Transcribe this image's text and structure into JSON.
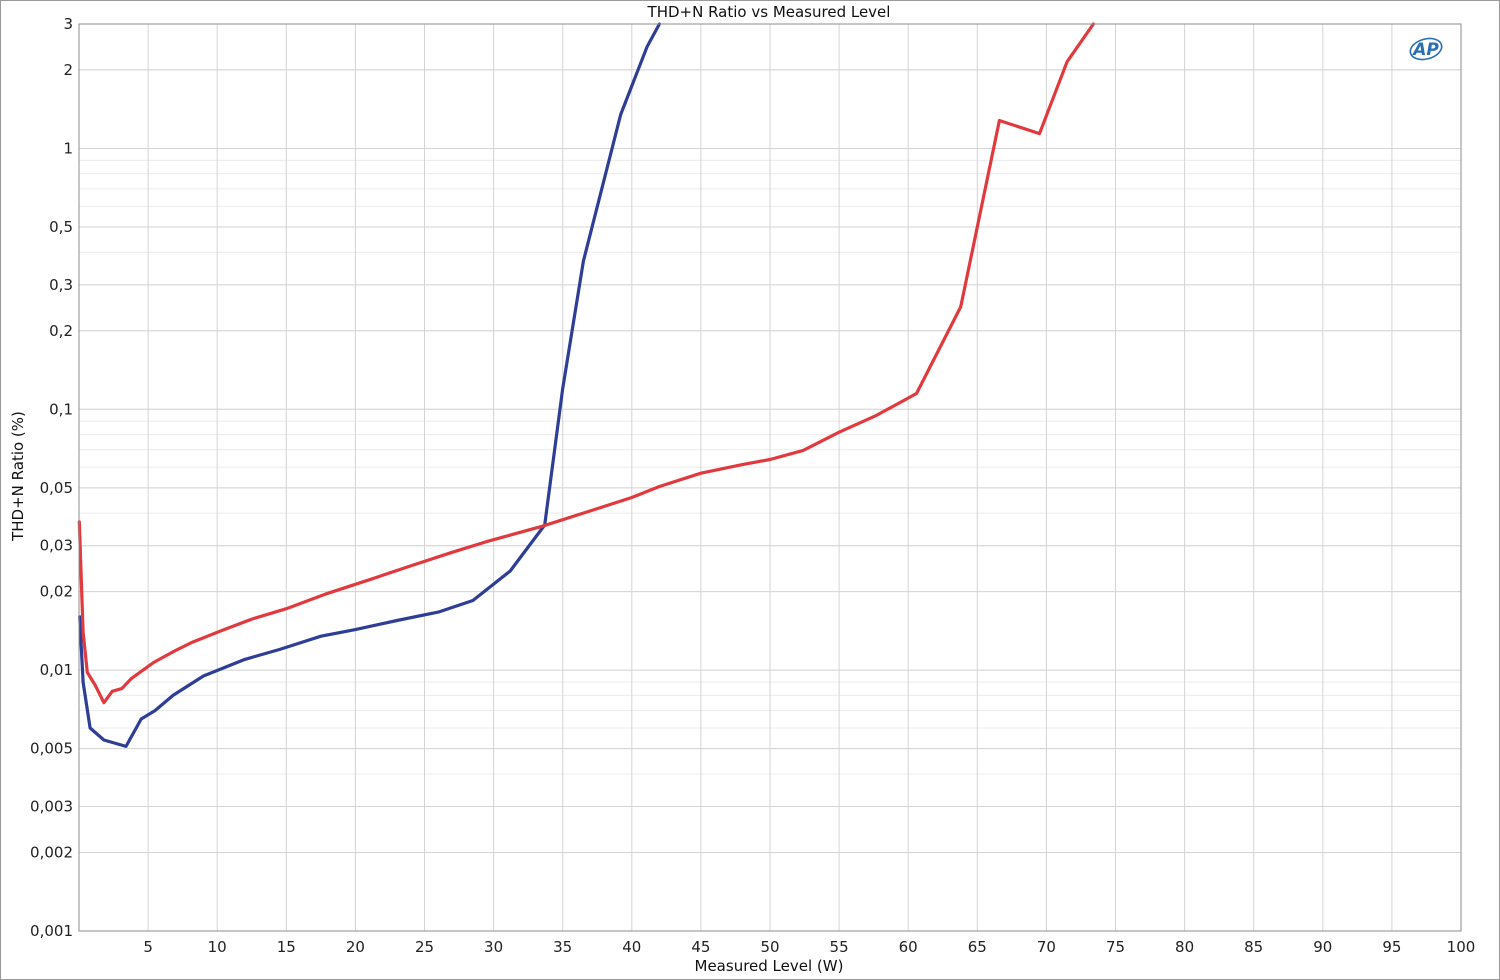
{
  "chart_data": {
    "type": "line",
    "title": "THD+N Ratio vs Measured Level",
    "xlabel": "Measured Level (W)",
    "ylabel": "THD+N Ratio (%)",
    "xlim": [
      0,
      100
    ],
    "ylim": [
      0.001,
      3
    ],
    "yscale": "log",
    "grid": true,
    "x_ticks": [
      5,
      10,
      15,
      20,
      25,
      30,
      35,
      40,
      45,
      50,
      55,
      60,
      65,
      70,
      75,
      80,
      85,
      90,
      95,
      100
    ],
    "x_tick_labels": [
      "5",
      "10",
      "15",
      "20",
      "25",
      "30",
      "35",
      "40",
      "45",
      "50",
      "55",
      "60",
      "65",
      "70",
      "75",
      "80",
      "85",
      "90",
      "95",
      "100"
    ],
    "y_ticks": [
      3,
      2,
      1,
      0.5,
      0.3,
      0.2,
      0.1,
      0.05,
      0.03,
      0.02,
      0.01,
      0.005,
      0.003,
      0.002,
      0.001
    ],
    "y_tick_labels": [
      "3",
      "2",
      "1",
      "0,5",
      "0,3",
      "0,2",
      "0,1",
      "0,05",
      "0,03",
      "0,02",
      "0,01",
      "0,005",
      "0,003",
      "0,002",
      "0,001"
    ],
    "series": [
      {
        "color": "#2e3d96",
        "points": [
          [
            0.05,
            0.016
          ],
          [
            0.3,
            0.009
          ],
          [
            0.8,
            0.006
          ],
          [
            1.8,
            0.0054
          ],
          [
            3.4,
            0.0051
          ],
          [
            4.5,
            0.0065
          ],
          [
            5.5,
            0.007
          ],
          [
            6.8,
            0.008
          ],
          [
            9,
            0.0095
          ],
          [
            12,
            0.011
          ],
          [
            14.5,
            0.012
          ],
          [
            17.5,
            0.0135
          ],
          [
            20,
            0.0143
          ],
          [
            23,
            0.0155
          ],
          [
            26,
            0.0167
          ],
          [
            28.5,
            0.0185
          ],
          [
            31.2,
            0.024
          ],
          [
            33.7,
            0.036
          ],
          [
            35,
            0.12
          ],
          [
            36.5,
            0.37
          ],
          [
            39.2,
            1.35
          ],
          [
            41.1,
            2.45
          ],
          [
            42,
            3.0
          ]
        ]
      },
      {
        "color": "#e0393e",
        "points": [
          [
            0.02,
            0.037
          ],
          [
            0.3,
            0.014
          ],
          [
            0.6,
            0.0098
          ],
          [
            1.2,
            0.0087
          ],
          [
            1.8,
            0.0075
          ],
          [
            2.4,
            0.0083
          ],
          [
            3.1,
            0.0085
          ],
          [
            3.8,
            0.0093
          ],
          [
            5.4,
            0.0107
          ],
          [
            7,
            0.0119
          ],
          [
            8.2,
            0.0128
          ],
          [
            10.5,
            0.0143
          ],
          [
            12.5,
            0.0157
          ],
          [
            15,
            0.0172
          ],
          [
            18,
            0.0197
          ],
          [
            21,
            0.0222
          ],
          [
            24,
            0.0251
          ],
          [
            27,
            0.0283
          ],
          [
            29.5,
            0.0311
          ],
          [
            33.5,
            0.0356
          ],
          [
            37,
            0.0408
          ],
          [
            40,
            0.0459
          ],
          [
            42,
            0.0506
          ],
          [
            45,
            0.0569
          ],
          [
            48,
            0.0614
          ],
          [
            50,
            0.0642
          ],
          [
            52.4,
            0.0696
          ],
          [
            55,
            0.0817
          ],
          [
            57.7,
            0.0948
          ],
          [
            60.6,
            0.115
          ],
          [
            63.8,
            0.247
          ],
          [
            66.6,
            1.28
          ],
          [
            69.5,
            1.14
          ],
          [
            71.5,
            2.15
          ],
          [
            73.4,
            3.0
          ]
        ]
      }
    ]
  },
  "logo": {
    "text": "AP"
  }
}
